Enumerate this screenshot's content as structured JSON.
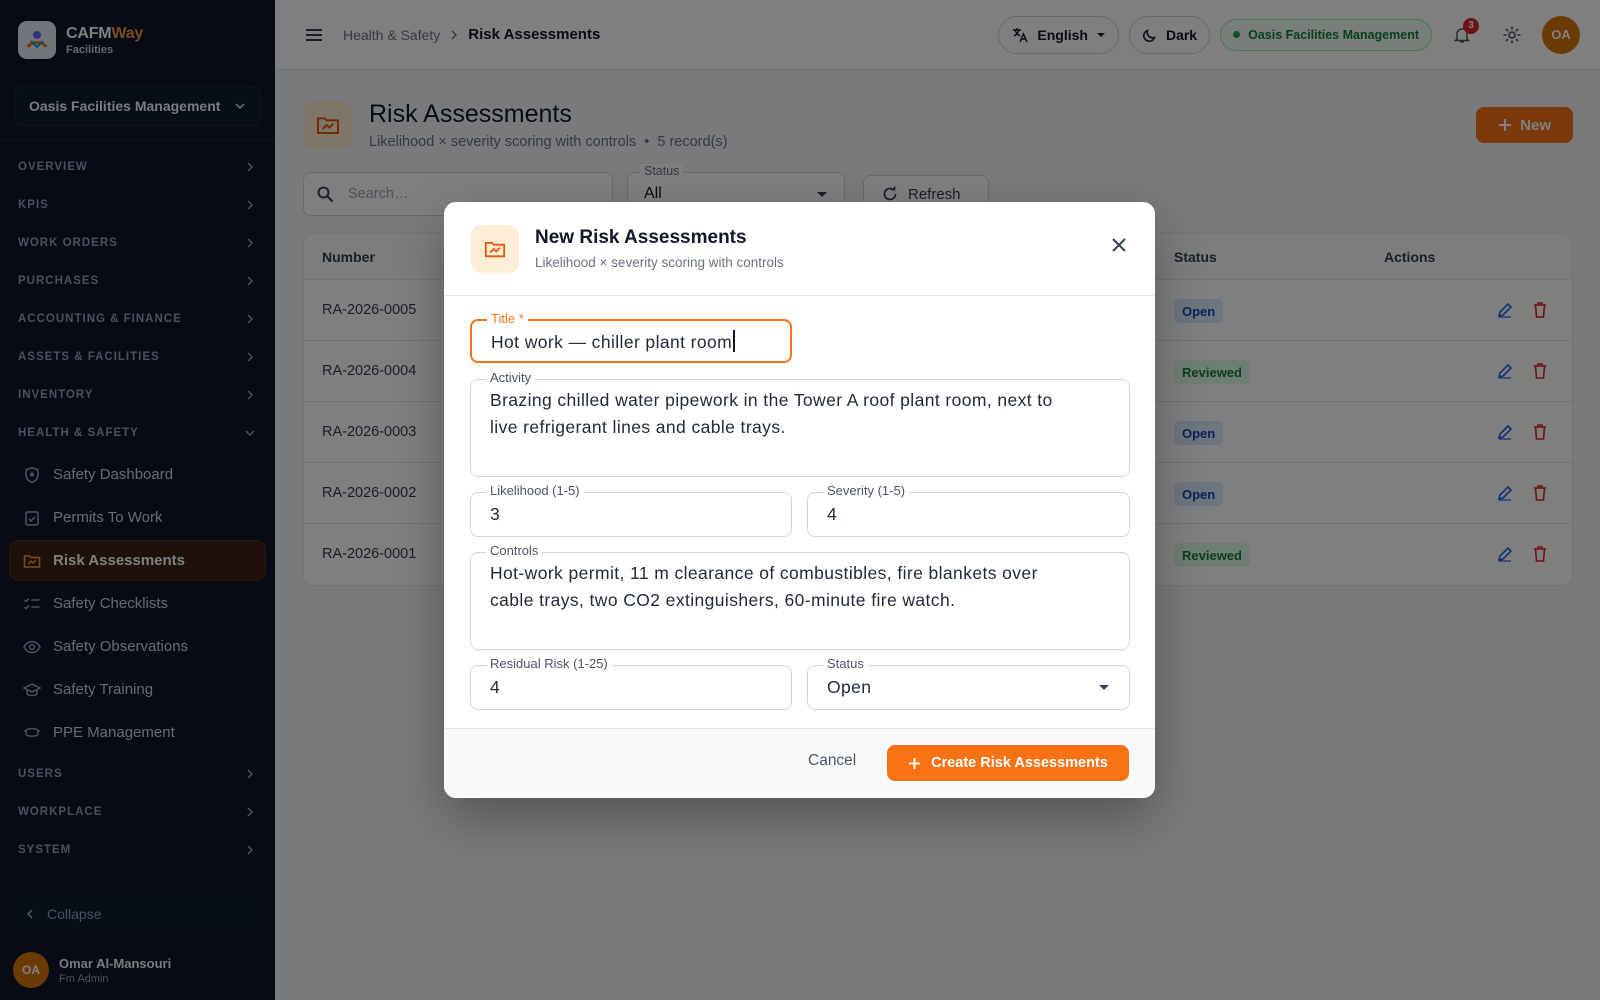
{
  "sidebar": {
    "brand_cafm": "CAFM",
    "brand_way": "Way",
    "brand_sub": "Facilities",
    "org": "Oasis Facilities Management",
    "sections": [
      {
        "label": "OVERVIEW"
      },
      {
        "label": "KPIS"
      },
      {
        "label": "WORK ORDERS"
      },
      {
        "label": "PURCHASES"
      },
      {
        "label": "ACCOUNTING & FINANCE"
      },
      {
        "label": "ASSETS & FACILITIES"
      },
      {
        "label": "INVENTORY"
      },
      {
        "label": "HEALTH & SAFETY"
      },
      {
        "label": "USERS"
      },
      {
        "label": "WORKPLACE"
      },
      {
        "label": "SYSTEM"
      }
    ],
    "hs_items": [
      {
        "label": "Safety Dashboard",
        "icon": "shield-icon"
      },
      {
        "label": "Permits To Work",
        "icon": "clipboard-check-icon"
      },
      {
        "label": "Risk Assessments",
        "icon": "folder-chart-icon",
        "active": true
      },
      {
        "label": "Safety Checklists",
        "icon": "checklist-icon"
      },
      {
        "label": "Safety Observations",
        "icon": "eye-icon"
      },
      {
        "label": "Safety Training",
        "icon": "graduation-cap-icon"
      },
      {
        "label": "PPE Management",
        "icon": "mask-icon"
      }
    ],
    "collapse_label": "Collapse",
    "user": {
      "initials": "OA",
      "name": "Omar Al-Mansouri",
      "role": "Fm Admin"
    }
  },
  "topbar": {
    "breadcrumb_parent": "Health & Safety",
    "breadcrumb_current": "Risk Assessments",
    "language": "English",
    "theme": "Dark",
    "org": "Oasis Facilities Management",
    "notifications": "3",
    "avatar": "OA"
  },
  "page": {
    "title": "Risk Assessments",
    "subtitle": "Likelihood × severity scoring with controls",
    "separator": "•",
    "records": "5 record(s)",
    "new_label": "New",
    "search_placeholder": "Search…",
    "status_label": "Status",
    "status_value": "All",
    "refresh_label": "Refresh"
  },
  "table": {
    "columns": {
      "number": "Number",
      "status": "Status",
      "actions": "Actions"
    },
    "rows": [
      {
        "number": "RA-2026-0005",
        "status": "Open"
      },
      {
        "number": "RA-2026-0004",
        "status": "Reviewed"
      },
      {
        "number": "RA-2026-0003",
        "status": "Open"
      },
      {
        "number": "RA-2026-0002",
        "status": "Open"
      },
      {
        "number": "RA-2026-0001",
        "status": "Reviewed"
      }
    ]
  },
  "modal": {
    "title": "New Risk Assessments",
    "subtitle": "Likelihood × severity scoring with controls",
    "fields": {
      "title_label": "Title *",
      "title_value": "Hot work — chiller plant room",
      "activity_label": "Activity",
      "activity_line1": "Brazing chilled water pipework in the Tower A roof plant room, next to",
      "activity_line2": "live refrigerant lines and cable trays.",
      "likelihood_label": "Likelihood (1-5)",
      "likelihood_value": "3",
      "severity_label": "Severity (1-5)",
      "severity_value": "4",
      "controls_label": "Controls",
      "controls_line1": "Hot-work permit, 11 m clearance of combustibles, fire blankets over",
      "controls_line2": "cable trays, two CO2 extinguishers, 60-minute fire watch.",
      "residual_label": "Residual Risk (1-25)",
      "residual_value": "4",
      "status_label": "Status",
      "status_value": "Open"
    },
    "cancel_label": "Cancel",
    "create_label": "Create Risk Assessments"
  },
  "colors": {
    "accent": "#f97316",
    "sidebar_bg": "#0f172a",
    "open_badge": "#dbeafe",
    "reviewed_badge": "#dcfce7"
  }
}
